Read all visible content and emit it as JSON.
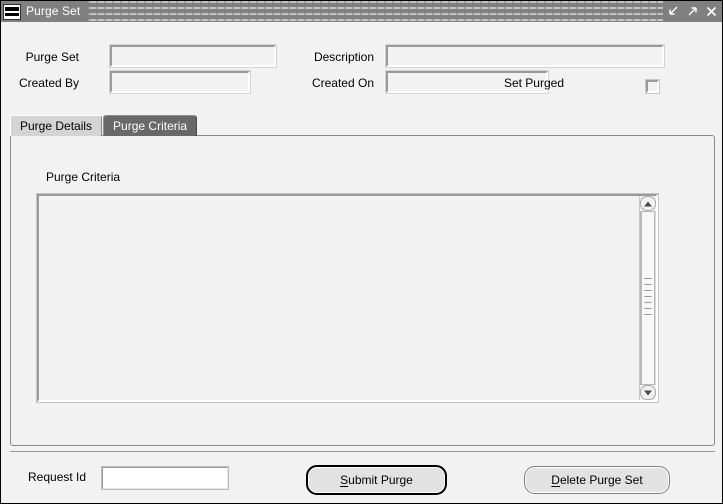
{
  "window": {
    "title": "Purge Set",
    "icon": "oracle-logo-icon",
    "controls": {
      "minimize": "minimize-icon",
      "maximize": "maximize-icon",
      "close": "close-icon"
    }
  },
  "header_form": {
    "purge_set": {
      "label": "Purge Set",
      "value": ""
    },
    "created_by": {
      "label": "Created By",
      "value": ""
    },
    "description": {
      "label": "Description",
      "value": ""
    },
    "created_on": {
      "label": "Created On",
      "value": ""
    },
    "set_purged": {
      "label": "Set Purged",
      "checked": false
    }
  },
  "tabs": [
    {
      "label": "Purge Details",
      "active": false
    },
    {
      "label": "Purge Criteria",
      "active": true
    }
  ],
  "panel": {
    "title": "Purge Criteria",
    "criteria_text": "",
    "scrollbar": {
      "up_arrow": "scroll-up-icon",
      "down_arrow": "scroll-down-icon"
    }
  },
  "footer": {
    "request_id": {
      "label": "Request Id",
      "value": ""
    },
    "submit_button": {
      "mnemonic": "S",
      "rest": "ubmit Purge"
    },
    "delete_button": {
      "mnemonic": "D",
      "rest": "elete Purge Set"
    }
  },
  "colors": {
    "window_bg": "#f2f2f2",
    "titlebar": "#808080",
    "tab_active": "#686868",
    "tab_inactive": "#d4d4d4",
    "field_bg": "#f2f2f2",
    "input_white": "#ffffff"
  }
}
